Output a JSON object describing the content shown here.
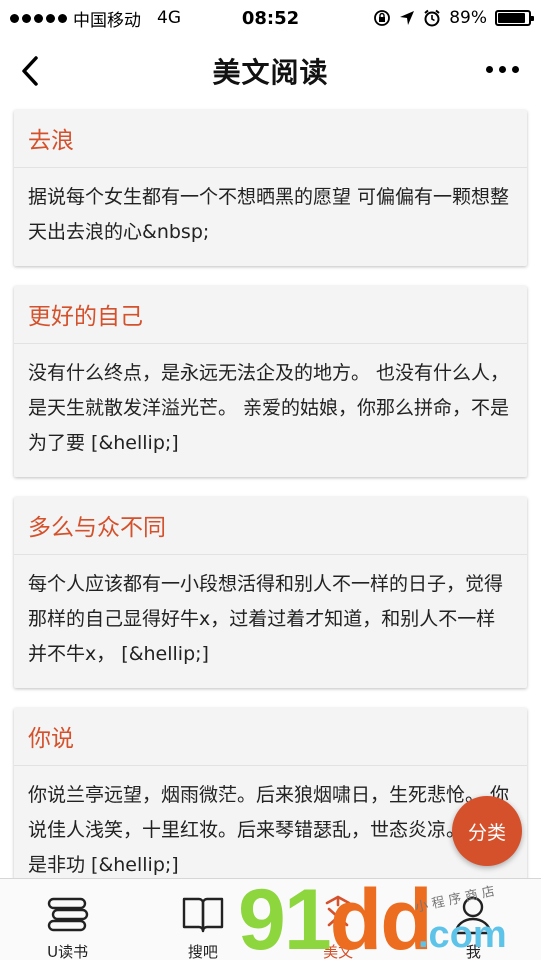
{
  "status_bar": {
    "carrier": "中国移动",
    "network": "4G",
    "time": "08:52",
    "battery": "89%",
    "battery_level": 0.89
  },
  "nav": {
    "title": "美文阅读"
  },
  "articles": [
    {
      "title": "去浪",
      "excerpt": "据说每个女生都有一个不想晒黑的愿望 可偏偏有一颗想整天出去浪的心&nbsp;"
    },
    {
      "title": "更好的自己",
      "excerpt": "没有什么终点，是永远无法企及的地方。 也没有什么人，是天生就散发洋溢光芒。 亲爱的姑娘，你那么拼命，不是为了要 [&hellip;]"
    },
    {
      "title": "多么与众不同",
      "excerpt": "每个人应该都有一小段想活得和别人不一样的日子，觉得那样的自己显得好牛x，过着过着才知道，和别人不一样并不牛x， [&hellip;]"
    },
    {
      "title": "你说",
      "excerpt": "你说兰亭远望，烟雨微茫。后来狼烟啸日，生死悲怆。 你说佳人浅笑，十里红妆。后来琴错瑟乱，世态炎凉。 你说是非功 [&hellip;]"
    }
  ],
  "fab": {
    "label": "分类"
  },
  "tabs": [
    {
      "label": "U读书",
      "icon": "books-stack-icon"
    },
    {
      "label": "搜吧",
      "icon": "open-book-icon"
    },
    {
      "label": "美文",
      "icon": "article-icon"
    },
    {
      "label": "我",
      "icon": "user-icon"
    }
  ],
  "watermark": {
    "brand_digits": "91",
    "brand_letters": "dd",
    "domain": ".com",
    "shop": "小程序商店"
  },
  "colors": {
    "accent": "#d4512c",
    "card_bg": "#f4f4f4",
    "tab_bar_bg": "#fafafa"
  }
}
